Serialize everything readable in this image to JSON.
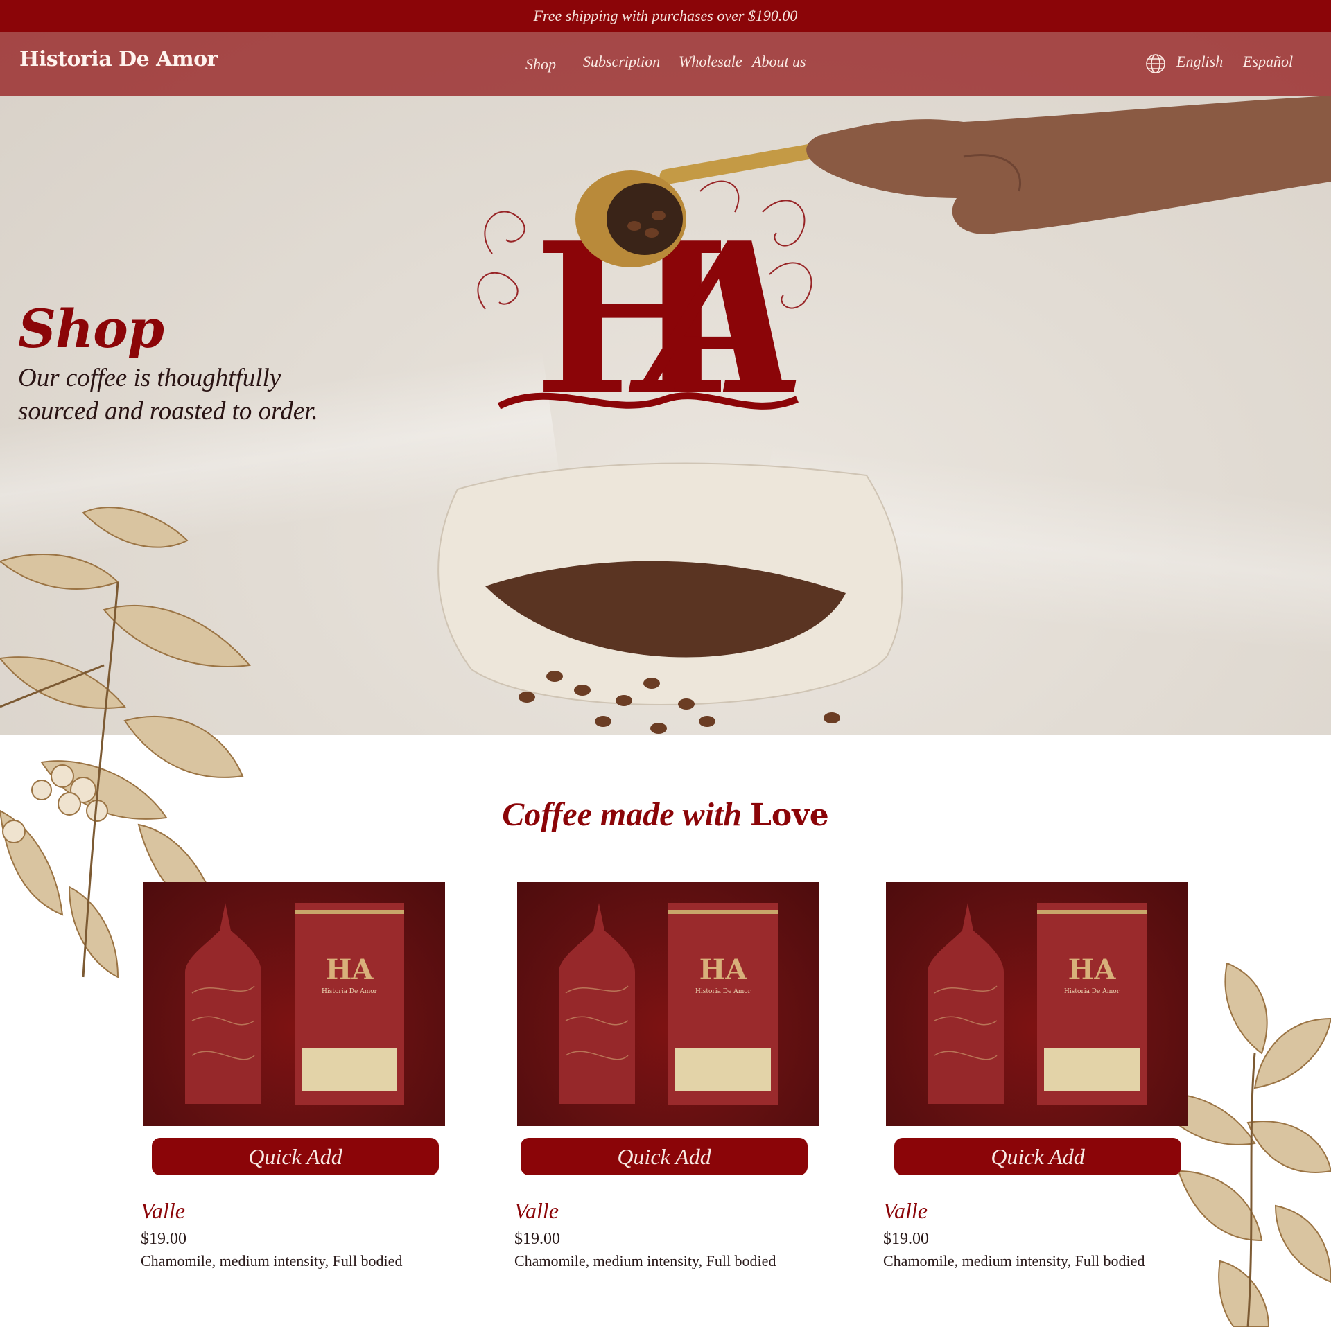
{
  "announcement": {
    "text": "Free shipping with purchases over $190.00"
  },
  "header": {
    "logo": "Historia De Amor",
    "nav": [
      "Shop",
      "Subscription",
      "Wholesale",
      "About us"
    ],
    "languages": [
      "English",
      "Español"
    ]
  },
  "hero": {
    "title": "Shop",
    "subtitle": "Our coffee is thoughtfully sourced and roasted to order."
  },
  "section": {
    "title_prefix": "Coffee made with ",
    "title_emphasis": "Love"
  },
  "products": [
    {
      "quick_add": "Quick Add",
      "name": "Valle",
      "price": "$19.00",
      "description": "Chamomile, medium intensity, Full bodied",
      "bag_brand": "Historia De Amor"
    },
    {
      "quick_add": "Quick Add",
      "name": "Valle",
      "price": "$19.00",
      "description": "Chamomile, medium intensity, Full bodied",
      "bag_brand": "Historia De Amor"
    },
    {
      "quick_add": "Quick Add",
      "name": "Valle",
      "price": "$19.00",
      "description": "Chamomile, medium intensity, Full bodied",
      "bag_brand": "Historia De Amor"
    }
  ],
  "colors": {
    "brand": "#8b0508",
    "hero_bg": "#e2dcd4",
    "botanical": "#b08a55"
  },
  "icons": [
    "globe-icon"
  ]
}
